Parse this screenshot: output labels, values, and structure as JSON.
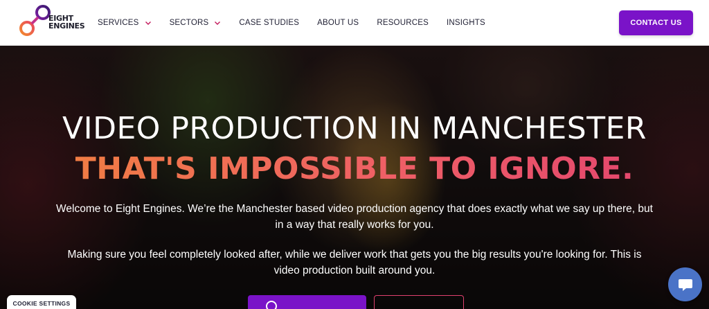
{
  "header": {
    "logo_line1": "EIGHT",
    "logo_line2": "ENGINES",
    "nav": [
      {
        "label": "SERVICES",
        "has_dropdown": true
      },
      {
        "label": "SECTORS",
        "has_dropdown": true
      },
      {
        "label": "CASE STUDIES",
        "has_dropdown": false
      },
      {
        "label": "ABOUT US",
        "has_dropdown": false
      },
      {
        "label": "RESOURCES",
        "has_dropdown": false
      },
      {
        "label": "INSIGHTS",
        "has_dropdown": false
      }
    ],
    "contact_label": "CONTACT US"
  },
  "hero": {
    "title": "VIDEO PRODUCTION IN MANCHESTER",
    "subtitle": "THAT'S IMPOSSIBLE TO IGNORE.",
    "paragraph1": "Welcome to Eight Engines. We’re the Manchester based video production agency that does exactly what we say up there, but in a way that really works for you.",
    "paragraph2": "Making sure you feel completely looked after, while we deliver work that gets you the big results you're looking for. This is video production built around you."
  },
  "cookie_label": "COOKIE SETTINGS",
  "icons": {
    "logo": "eight-engines-logo",
    "chevron": "chevron-down-icon",
    "chat": "chat-bubble-icon",
    "play": "play-ring-icon"
  },
  "colors": {
    "accent_purple": "#7a13c8",
    "chevron_pink": "#c2185b",
    "gradient_start": "#f0833c",
    "gradient_end": "#e0416f",
    "chat_blue": "#4a73c7",
    "nav_text": "#1f1f33"
  }
}
